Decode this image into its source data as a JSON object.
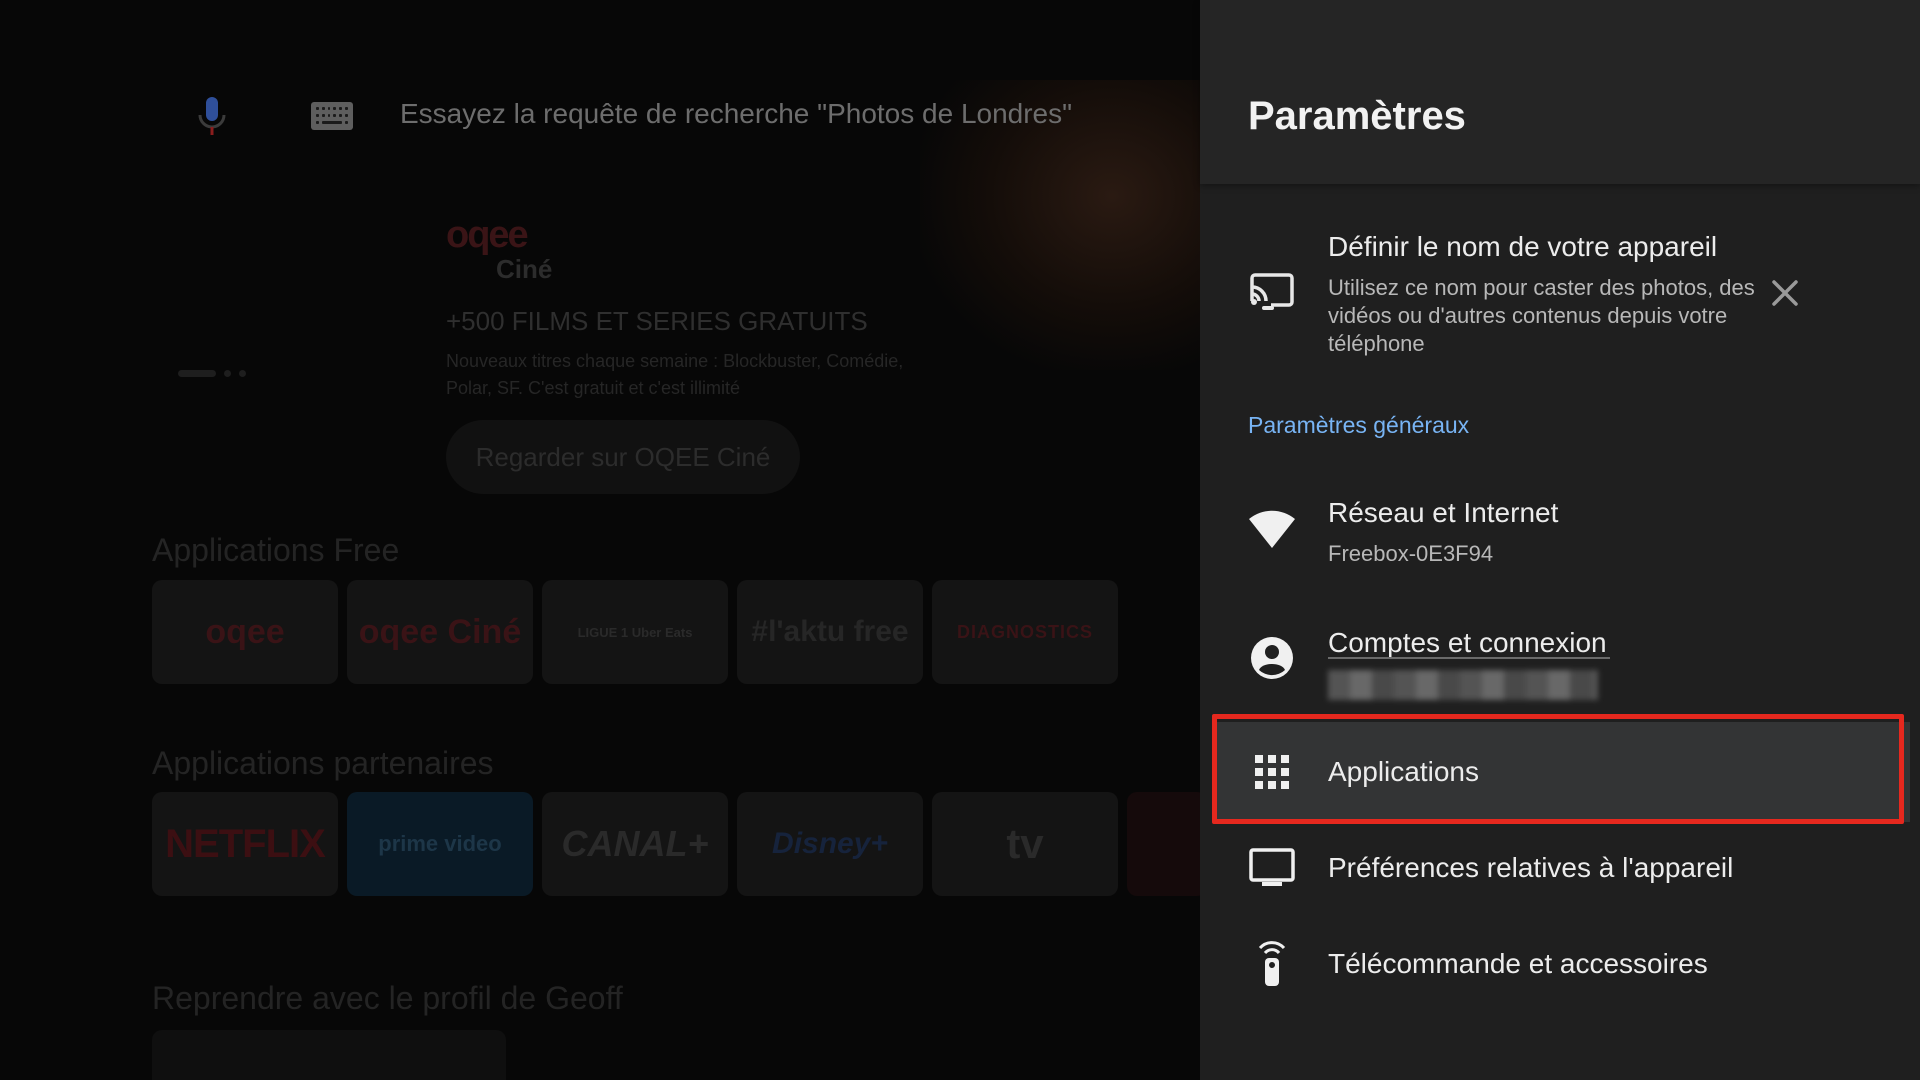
{
  "home": {
    "search_hint": "Essayez la requête de recherche \"Photos de Londres\"",
    "hero": {
      "logo_main": "oqee",
      "logo_sub": "Ciné",
      "title": "+500 FILMS ET SERIES GRATUITS",
      "subtitle": "Nouveaux titres chaque semaine : Blockbuster, Comédie, Polar, SF. C'est gratuit et c'est illimité",
      "button": "Regarder sur OQEE Ciné"
    },
    "rows": [
      {
        "title": "Applications Free",
        "tiles": [
          "oqee",
          "oqee Ciné",
          "LIGUE 1 Uber Eats",
          "#l'aktu free",
          "DIAGNOSTICS"
        ]
      },
      {
        "title": "Applications partenaires",
        "tiles": [
          "NETFLIX",
          "prime video",
          "CANAL+",
          "Disney+",
          "tv"
        ]
      }
    ],
    "resume_title": "Reprendre avec le profil de Geoff"
  },
  "panel": {
    "title": "Paramètres",
    "suggestion": {
      "title": "Définir le nom de votre appareil",
      "description": "Utilisez ce nom pour caster des photos, des vidéos ou d'autres contenus depuis votre téléphone",
      "icon": "cast-icon"
    },
    "section_header": "Paramètres généraux",
    "items": [
      {
        "label": "Réseau et Internet",
        "sublabel": "Freebox-0E3F94",
        "icon": "wifi-icon"
      },
      {
        "label": "Comptes et connexion",
        "sublabel": "",
        "icon": "account-icon"
      },
      {
        "label": "Applications",
        "icon": "apps-grid-icon"
      },
      {
        "label": "Préférences relatives à l'appareil",
        "icon": "tv-icon"
      },
      {
        "label": "Télécommande et accessoires",
        "icon": "remote-icon"
      }
    ],
    "colors": {
      "accent": "#78b4f4",
      "highlight": "#e5281e",
      "panel_bg": "#1f1f1f"
    }
  }
}
